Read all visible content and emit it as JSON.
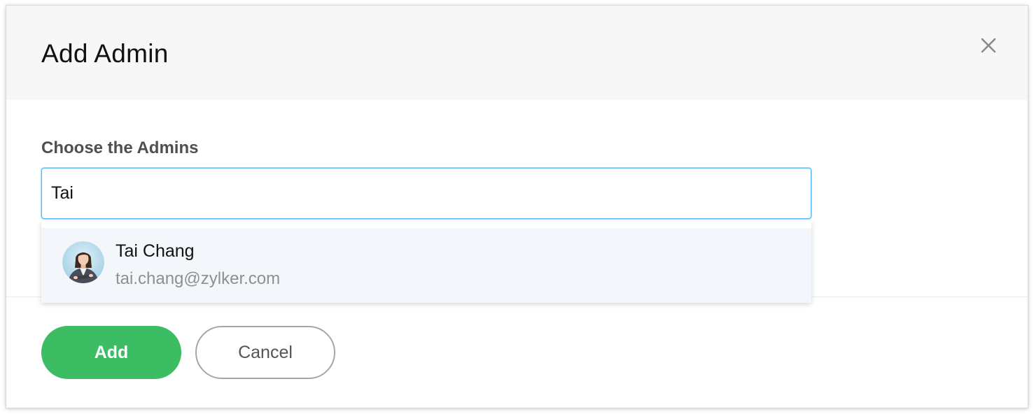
{
  "dialog": {
    "title": "Add Admin",
    "close_icon": "close-icon"
  },
  "form": {
    "label": "Choose the Admins",
    "search_value": "Tai"
  },
  "suggestions": [
    {
      "name": "Tai Chang",
      "email": "tai.chang@zylker.com",
      "avatar": "user-avatar"
    }
  ],
  "footer": {
    "add_label": "Add",
    "cancel_label": "Cancel"
  },
  "colors": {
    "primary": "#3dbd63",
    "focus_border": "#58bdf0",
    "header_bg": "#f7f7f7",
    "suggestion_bg": "#f3f6fa"
  }
}
